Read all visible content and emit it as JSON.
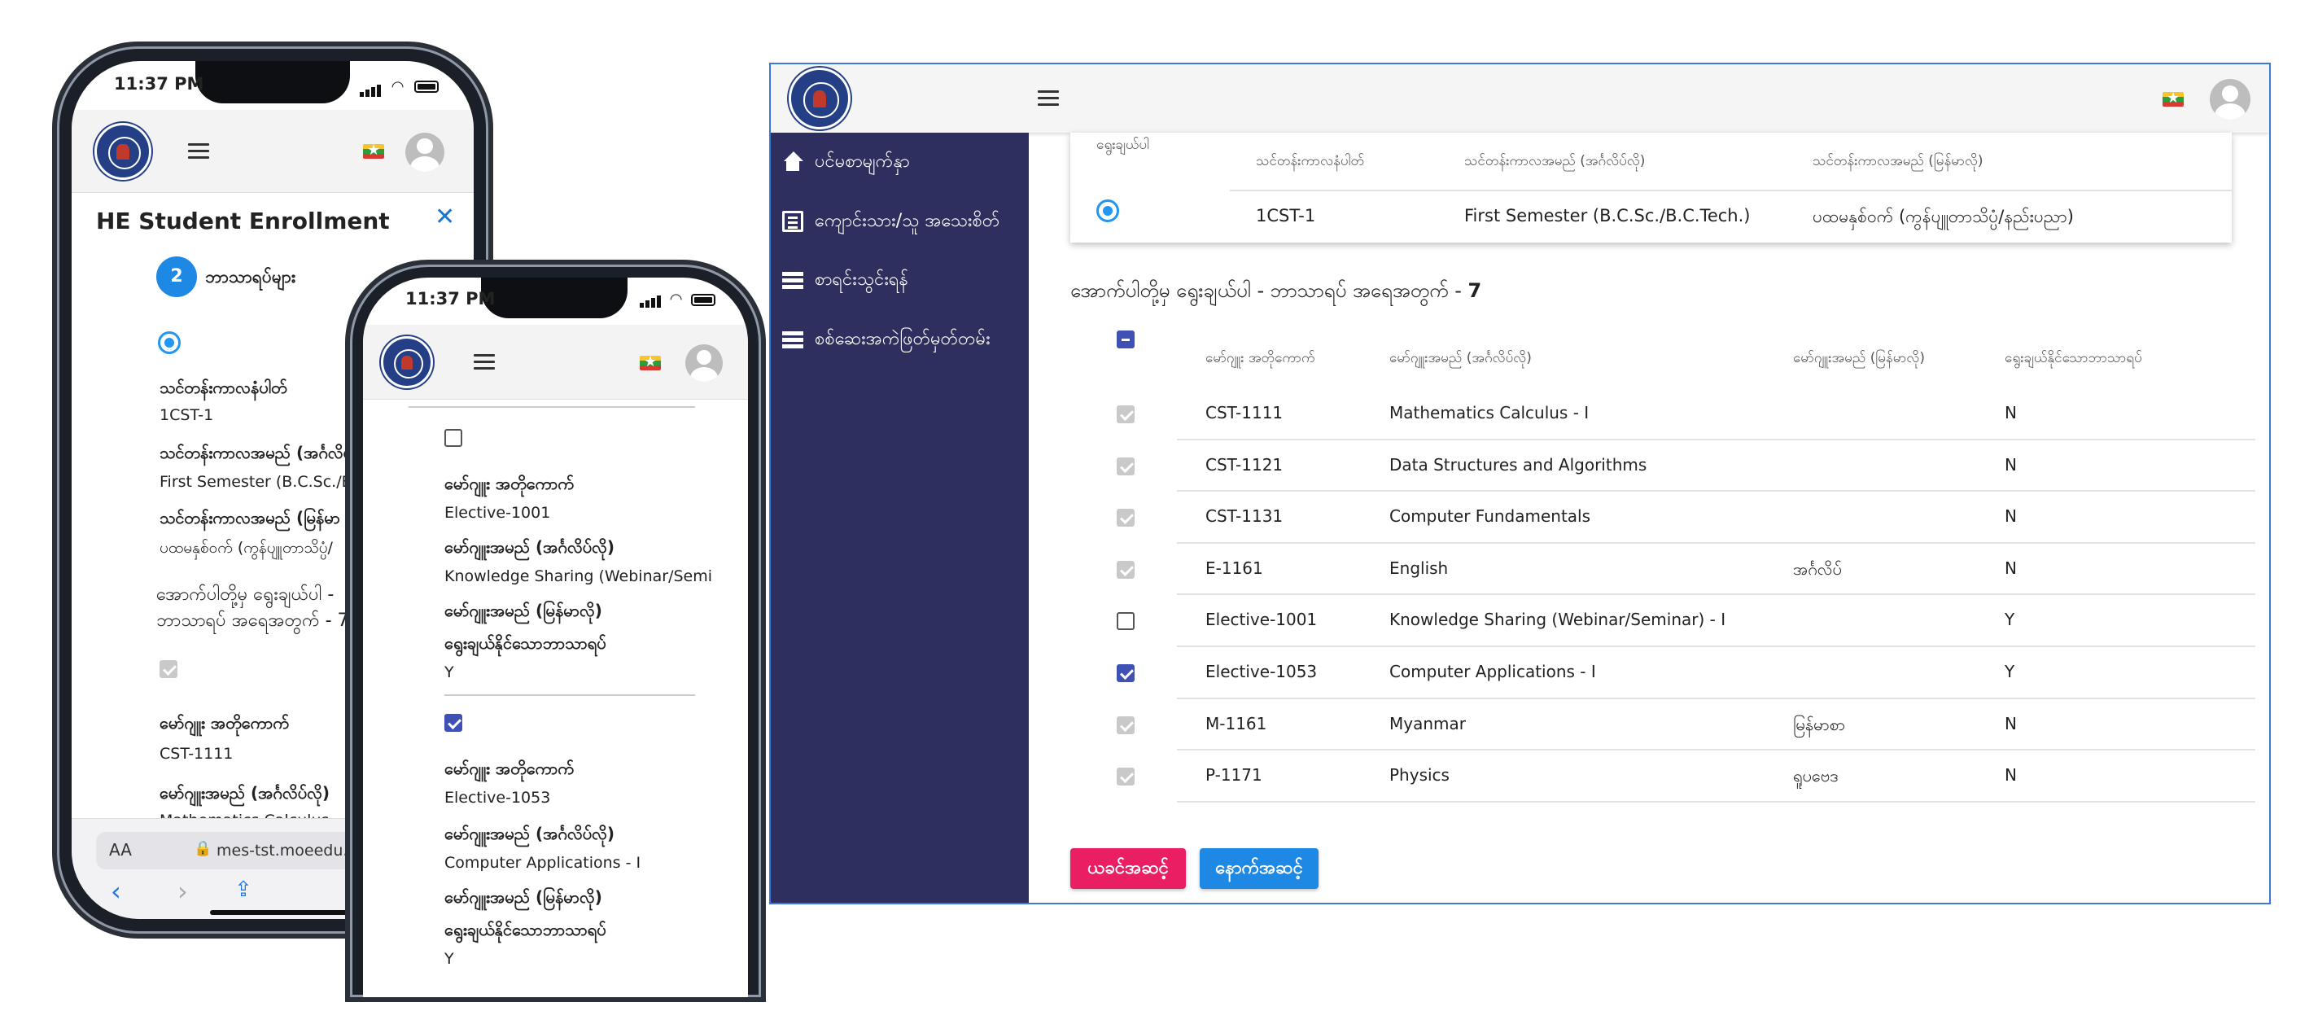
{
  "phone1": {
    "time": "11:37 PM",
    "title": "HE Student Enrollment",
    "step_number": "2",
    "step_label": "ဘာသာရပ်များ",
    "fields": [
      {
        "label": "သင်တန်းကာလနံပါတ်",
        "value": "1CST-1"
      },
      {
        "label": "သင်တန်းကာလအမည် (အင်္ဂလိပ်",
        "value": "First Semester (B.C.Sc./B.C."
      },
      {
        "label": "သင်တန်းကာလအမည် (မြန်မာ",
        "value": "ပထမနှစ်ဝက် (ကွန်ပျူတာသိပ္ပံ/"
      }
    ],
    "select_prompt_line1": "အောက်ပါတို့မှ ရွေးချယ်ပါ -",
    "select_prompt_line2": "ဘာသာရပ် အရေအတွက် - 7",
    "course_label_code": "မော်ဂျူး အတိုကောက်",
    "course_value_code": "CST-1111",
    "course_label_en": "မော်ဂျူးအမည် (အင်္ဂလိပ်လို)",
    "course_value_en": "Mathematics Calculus - I",
    "aa": "AA",
    "url": "mes-tst.moeedu.or"
  },
  "phone2": {
    "time": "11:37 PM",
    "courses": [
      {
        "code_label": "မော်ဂျူး အတိုကောက်",
        "code": "Elective-1001",
        "en_label": "မော်ဂျူးအမည် (အင်္ဂလိပ်လို)",
        "en": "Knowledge Sharing (Webinar/Seminar",
        "mm_label": "မော်ဂျူးအမည် (မြန်မာလို)",
        "opt_label": "ရွေးချယ်နိုင်သောဘာသာရပ်",
        "opt": "Y"
      },
      {
        "code_label": "မော်ဂျူး အတိုကောက်",
        "code": "Elective-1053",
        "en_label": "မော်ဂျူးအမည် (အင်္ဂလိပ်လို)",
        "en": "Computer Applications - I",
        "mm_label": "မော်ဂျူးအမည် (မြန်မာလို)",
        "opt_label": "ရွေးချယ်နိုင်သောဘာသာရပ်",
        "opt": "Y"
      }
    ]
  },
  "desktop": {
    "nav": [
      {
        "icon": "home-icon",
        "label": "ပင်မစာမျက်နှာ"
      },
      {
        "icon": "document-icon",
        "label": "ကျောင်းသား/သူ အသေးစိတ်"
      },
      {
        "icon": "list-icon",
        "label": "စာရင်းသွင်းရန်"
      },
      {
        "icon": "list-icon",
        "label": "စစ်ဆေးအကဲဖြတ်မှတ်တမ်း"
      }
    ],
    "semester_table": {
      "headers": [
        "ရွေးချယ်ပါ",
        "သင်တန်းကာလနံပါတ်",
        "သင်တန်းကာလအမည် (အင်္ဂလိပ်လို)",
        "သင်တန်းကာလအမည် (မြန်မာလို)"
      ],
      "row": [
        "1CST-1",
        "First Semester (B.C.Sc./B.C.Tech.)",
        "ပထမနှစ်ဝက် (ကွန်ပျူတာသိပ္ပံ/နည်းပညာ)"
      ]
    },
    "select_prompt": "အောက်ပါတို့မှ ရွေးချယ်ပါ - ဘာသာရပ် အရေအတွက် -",
    "select_count": "7",
    "course_headers": [
      "မော်ဂျူး အတိုကောက်",
      "မော်ဂျူးအမည် (အင်္ဂလိပ်လို)",
      "မော်ဂျူးအမည် (မြန်မာလို)",
      "ရွေးချယ်နိုင်သောဘာသာရပ်"
    ],
    "courses": [
      {
        "code": "CST-1111",
        "en": "Mathematics Calculus - I",
        "mm": "",
        "opt": "N",
        "state": "disabled"
      },
      {
        "code": "CST-1121",
        "en": "Data Structures and Algorithms",
        "mm": "",
        "opt": "N",
        "state": "disabled"
      },
      {
        "code": "CST-1131",
        "en": "Computer Fundamentals",
        "mm": "",
        "opt": "N",
        "state": "disabled"
      },
      {
        "code": "E-1161",
        "en": "English",
        "mm": "အင်္ဂလိပ်",
        "opt": "N",
        "state": "disabled"
      },
      {
        "code": "Elective-1001",
        "en": "Knowledge Sharing (Webinar/Seminar) - I",
        "mm": "",
        "opt": "Y",
        "state": "unchecked"
      },
      {
        "code": "Elective-1053",
        "en": "Computer Applications - I",
        "mm": "",
        "opt": "Y",
        "state": "checked"
      },
      {
        "code": "M-1161",
        "en": "Myanmar",
        "mm": "မြန်မာစာ",
        "opt": "N",
        "state": "disabled"
      },
      {
        "code": "P-1171",
        "en": "Physics",
        "mm": "ရူပဗေဒ",
        "opt": "N",
        "state": "disabled"
      }
    ],
    "prev_button": "ယခင်အဆင့်",
    "next_button": "နောက်အဆင့်"
  },
  "colors": {
    "sidebar": "#2e2f5e",
    "primary": "#3f51b5",
    "radio": "#2196f3",
    "prev_button": "#e91e63",
    "next_button": "#1e88e5"
  }
}
